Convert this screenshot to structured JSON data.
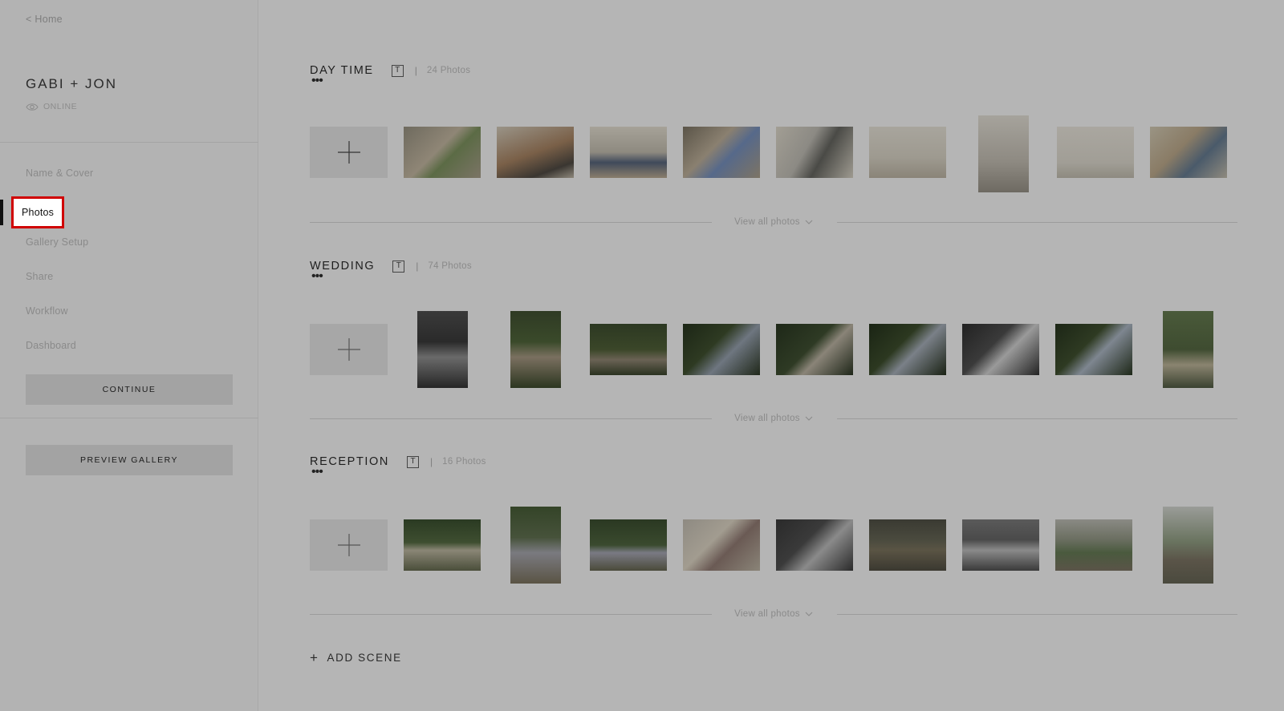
{
  "sidebar": {
    "back_link": "< Home",
    "gallery_title": "GABI + JON",
    "status": "ONLINE",
    "nav": [
      {
        "label": "Name & Cover",
        "active": false
      },
      {
        "label": "Photos",
        "active": true
      },
      {
        "label": "Gallery Setup",
        "active": false
      },
      {
        "label": "Share",
        "active": false
      },
      {
        "label": "Workflow",
        "active": false
      },
      {
        "label": "Dashboard",
        "active": false
      }
    ],
    "continue_label": "CONTINUE",
    "preview_label": "PREVIEW GALLERY"
  },
  "scenes": [
    {
      "title": "DAY TIME",
      "t_icon": "T",
      "separator": "|",
      "count": "24 Photos",
      "view_all": "View all photos"
    },
    {
      "title": "WEDDING",
      "t_icon": "T",
      "separator": "|",
      "count": "74 Photos",
      "view_all": "View all photos"
    },
    {
      "title": "RECEPTION",
      "t_icon": "T",
      "separator": "|",
      "count": "16 Photos",
      "view_all": "View all photos"
    }
  ],
  "add_scene": {
    "plus": "+",
    "label": "ADD SCENE"
  },
  "icons": {
    "eye": "eye-icon",
    "plus": "plus-icon",
    "chevron": "chevron-down-icon",
    "text": "text-icon"
  },
  "colors": {
    "overlay_bg": "#b5b5b5",
    "active_highlight": "#d00000",
    "active_indicator": "#111111"
  }
}
